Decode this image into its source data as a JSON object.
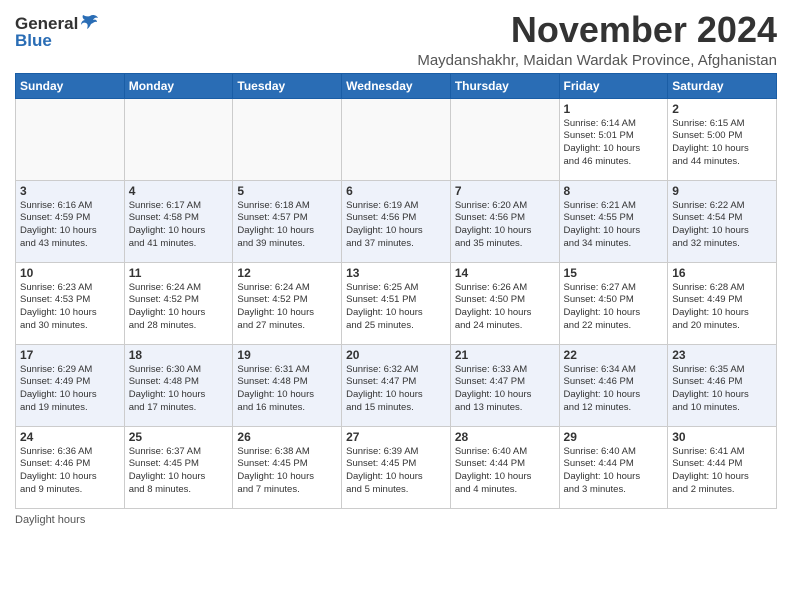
{
  "header": {
    "logo_general": "General",
    "logo_blue": "Blue",
    "month_title": "November 2024",
    "location": "Maydanshakhr, Maidan Wardak Province, Afghanistan"
  },
  "footer": {
    "daylight_label": "Daylight hours"
  },
  "weekdays": [
    "Sunday",
    "Monday",
    "Tuesday",
    "Wednesday",
    "Thursday",
    "Friday",
    "Saturday"
  ],
  "weeks": [
    {
      "days": [
        {
          "num": "",
          "info": ""
        },
        {
          "num": "",
          "info": ""
        },
        {
          "num": "",
          "info": ""
        },
        {
          "num": "",
          "info": ""
        },
        {
          "num": "",
          "info": ""
        },
        {
          "num": "1",
          "info": "Sunrise: 6:14 AM\nSunset: 5:01 PM\nDaylight: 10 hours\nand 46 minutes."
        },
        {
          "num": "2",
          "info": "Sunrise: 6:15 AM\nSunset: 5:00 PM\nDaylight: 10 hours\nand 44 minutes."
        }
      ]
    },
    {
      "days": [
        {
          "num": "3",
          "info": "Sunrise: 6:16 AM\nSunset: 4:59 PM\nDaylight: 10 hours\nand 43 minutes."
        },
        {
          "num": "4",
          "info": "Sunrise: 6:17 AM\nSunset: 4:58 PM\nDaylight: 10 hours\nand 41 minutes."
        },
        {
          "num": "5",
          "info": "Sunrise: 6:18 AM\nSunset: 4:57 PM\nDaylight: 10 hours\nand 39 minutes."
        },
        {
          "num": "6",
          "info": "Sunrise: 6:19 AM\nSunset: 4:56 PM\nDaylight: 10 hours\nand 37 minutes."
        },
        {
          "num": "7",
          "info": "Sunrise: 6:20 AM\nSunset: 4:56 PM\nDaylight: 10 hours\nand 35 minutes."
        },
        {
          "num": "8",
          "info": "Sunrise: 6:21 AM\nSunset: 4:55 PM\nDaylight: 10 hours\nand 34 minutes."
        },
        {
          "num": "9",
          "info": "Sunrise: 6:22 AM\nSunset: 4:54 PM\nDaylight: 10 hours\nand 32 minutes."
        }
      ]
    },
    {
      "days": [
        {
          "num": "10",
          "info": "Sunrise: 6:23 AM\nSunset: 4:53 PM\nDaylight: 10 hours\nand 30 minutes."
        },
        {
          "num": "11",
          "info": "Sunrise: 6:24 AM\nSunset: 4:52 PM\nDaylight: 10 hours\nand 28 minutes."
        },
        {
          "num": "12",
          "info": "Sunrise: 6:24 AM\nSunset: 4:52 PM\nDaylight: 10 hours\nand 27 minutes."
        },
        {
          "num": "13",
          "info": "Sunrise: 6:25 AM\nSunset: 4:51 PM\nDaylight: 10 hours\nand 25 minutes."
        },
        {
          "num": "14",
          "info": "Sunrise: 6:26 AM\nSunset: 4:50 PM\nDaylight: 10 hours\nand 24 minutes."
        },
        {
          "num": "15",
          "info": "Sunrise: 6:27 AM\nSunset: 4:50 PM\nDaylight: 10 hours\nand 22 minutes."
        },
        {
          "num": "16",
          "info": "Sunrise: 6:28 AM\nSunset: 4:49 PM\nDaylight: 10 hours\nand 20 minutes."
        }
      ]
    },
    {
      "days": [
        {
          "num": "17",
          "info": "Sunrise: 6:29 AM\nSunset: 4:49 PM\nDaylight: 10 hours\nand 19 minutes."
        },
        {
          "num": "18",
          "info": "Sunrise: 6:30 AM\nSunset: 4:48 PM\nDaylight: 10 hours\nand 17 minutes."
        },
        {
          "num": "19",
          "info": "Sunrise: 6:31 AM\nSunset: 4:48 PM\nDaylight: 10 hours\nand 16 minutes."
        },
        {
          "num": "20",
          "info": "Sunrise: 6:32 AM\nSunset: 4:47 PM\nDaylight: 10 hours\nand 15 minutes."
        },
        {
          "num": "21",
          "info": "Sunrise: 6:33 AM\nSunset: 4:47 PM\nDaylight: 10 hours\nand 13 minutes."
        },
        {
          "num": "22",
          "info": "Sunrise: 6:34 AM\nSunset: 4:46 PM\nDaylight: 10 hours\nand 12 minutes."
        },
        {
          "num": "23",
          "info": "Sunrise: 6:35 AM\nSunset: 4:46 PM\nDaylight: 10 hours\nand 10 minutes."
        }
      ]
    },
    {
      "days": [
        {
          "num": "24",
          "info": "Sunrise: 6:36 AM\nSunset: 4:46 PM\nDaylight: 10 hours\nand 9 minutes."
        },
        {
          "num": "25",
          "info": "Sunrise: 6:37 AM\nSunset: 4:45 PM\nDaylight: 10 hours\nand 8 minutes."
        },
        {
          "num": "26",
          "info": "Sunrise: 6:38 AM\nSunset: 4:45 PM\nDaylight: 10 hours\nand 7 minutes."
        },
        {
          "num": "27",
          "info": "Sunrise: 6:39 AM\nSunset: 4:45 PM\nDaylight: 10 hours\nand 5 minutes."
        },
        {
          "num": "28",
          "info": "Sunrise: 6:40 AM\nSunset: 4:44 PM\nDaylight: 10 hours\nand 4 minutes."
        },
        {
          "num": "29",
          "info": "Sunrise: 6:40 AM\nSunset: 4:44 PM\nDaylight: 10 hours\nand 3 minutes."
        },
        {
          "num": "30",
          "info": "Sunrise: 6:41 AM\nSunset: 4:44 PM\nDaylight: 10 hours\nand 2 minutes."
        }
      ]
    }
  ]
}
